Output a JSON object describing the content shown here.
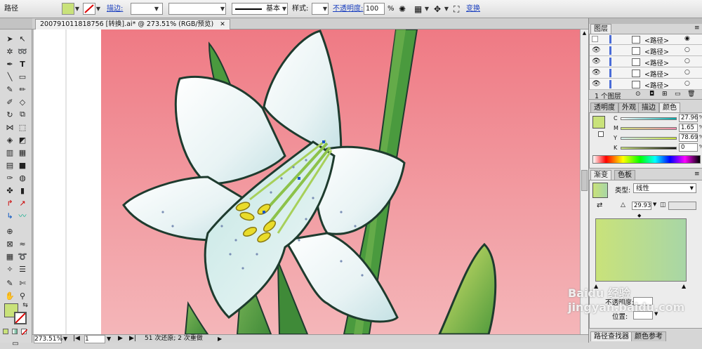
{
  "control_bar": {
    "selection_label": "路径",
    "stroke_label": "描边:",
    "stroke_style": "基本",
    "style_label": "样式:",
    "opacity_label": "不透明度:",
    "opacity_value": "100",
    "opacity_unit": "%",
    "transform_label": "变换",
    "fill_color": "#c9e27a"
  },
  "document": {
    "tab_title": "20079101181875​6 [转换].ai* @ 273.51% (RGB/预览)"
  },
  "status": {
    "zoom": "273.51%",
    "page": "1",
    "history": "51 次还原; 2 次重做"
  },
  "layers_panel": {
    "tab": "图层",
    "rows": [
      {
        "label": "<路径>"
      },
      {
        "label": "<路径>"
      },
      {
        "label": "<路径>"
      },
      {
        "label": "<路径>"
      },
      {
        "label": "<路径>"
      }
    ],
    "count_label": "1 个图层"
  },
  "color_panel": {
    "tabs": [
      "透明度",
      "外观",
      "描边",
      "颜色"
    ],
    "channels": [
      {
        "name": "C",
        "value": "27.96",
        "unit": "%"
      },
      {
        "name": "M",
        "value": "1.65",
        "unit": "%"
      },
      {
        "name": "Y",
        "value": "78.69",
        "unit": "%"
      },
      {
        "name": "K",
        "value": "0",
        "unit": "%"
      }
    ]
  },
  "gradient_panel": {
    "tabs": [
      "渐变",
      "色板"
    ],
    "type_label": "类型:",
    "type_value": "线性",
    "angle_value": "29.93",
    "opacity_label": "不透明度:",
    "location_label": "位置:",
    "start_color": "#c9e27a",
    "end_color": "#a8d6a6"
  },
  "bottom_tabs": [
    "路径查找器",
    "颜色参考"
  ],
  "watermark": "Baidu 经验 jingyan.baidu.com",
  "colors": {
    "background_top": "#ef7a84",
    "background_bottom": "#f4b6b9",
    "stem": "#4a9a3e",
    "petal_outline": "#1e3b2e",
    "stamen": "#e9dc2a"
  }
}
